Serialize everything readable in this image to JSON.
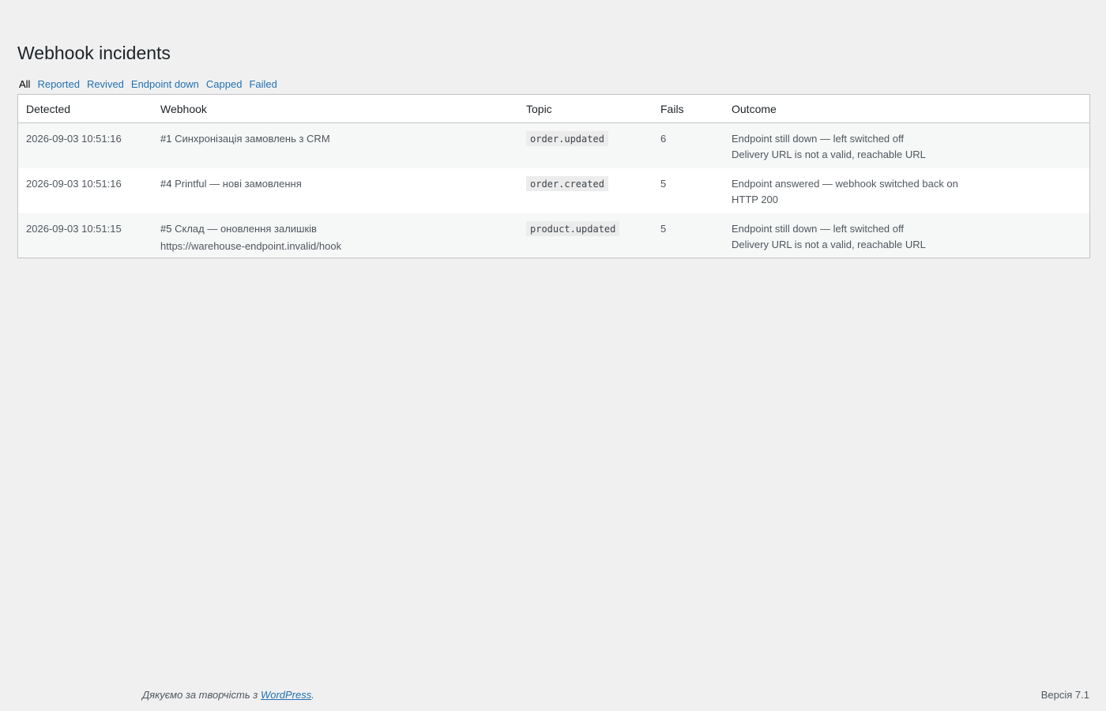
{
  "page": {
    "title": "Webhook incidents"
  },
  "filters": [
    {
      "label": "All",
      "current": true
    },
    {
      "label": "Reported",
      "current": false
    },
    {
      "label": "Revived",
      "current": false
    },
    {
      "label": "Endpoint down",
      "current": false
    },
    {
      "label": "Capped",
      "current": false
    },
    {
      "label": "Failed",
      "current": false
    }
  ],
  "table": {
    "columns": {
      "detected": "Detected",
      "webhook": "Webhook",
      "topic": "Topic",
      "fails": "Fails",
      "outcome": "Outcome"
    },
    "rows": [
      {
        "detected": "2026-09-03 10:51:16",
        "webhook_id": "#1",
        "webhook_name": "Синхронізація замовлень з CRM",
        "webhook_url": "",
        "topic": "order.updated",
        "fails": "6",
        "outcome": "Endpoint still down — left switched off",
        "outcome_detail": "Delivery URL is not a valid, reachable URL"
      },
      {
        "detected": "2026-09-03 10:51:16",
        "webhook_id": "#4",
        "webhook_name": "Printful — нові замовлення",
        "webhook_url": "",
        "topic": "order.created",
        "fails": "5",
        "outcome": "Endpoint answered — webhook switched back on",
        "outcome_detail": "HTTP 200"
      },
      {
        "detected": "2026-09-03 10:51:15",
        "webhook_id": "#5",
        "webhook_name": "Склад — оновлення залишків",
        "webhook_url": "https://warehouse-endpoint.invalid/hook",
        "topic": "product.updated",
        "fails": "5",
        "outcome": "Endpoint still down — left switched off",
        "outcome_detail": "Delivery URL is not a valid, reachable URL"
      }
    ]
  },
  "footer": {
    "thanks_prefix": "Дякуємо за творчість з ",
    "thanks_link": "WordPress",
    "thanks_suffix": ".",
    "version": "Версія 7.1"
  },
  "colors": {
    "background": "#f0f0f1",
    "link": "#2271b1",
    "border": "#c3c4c7",
    "row_alt": "#f6f7f7"
  }
}
